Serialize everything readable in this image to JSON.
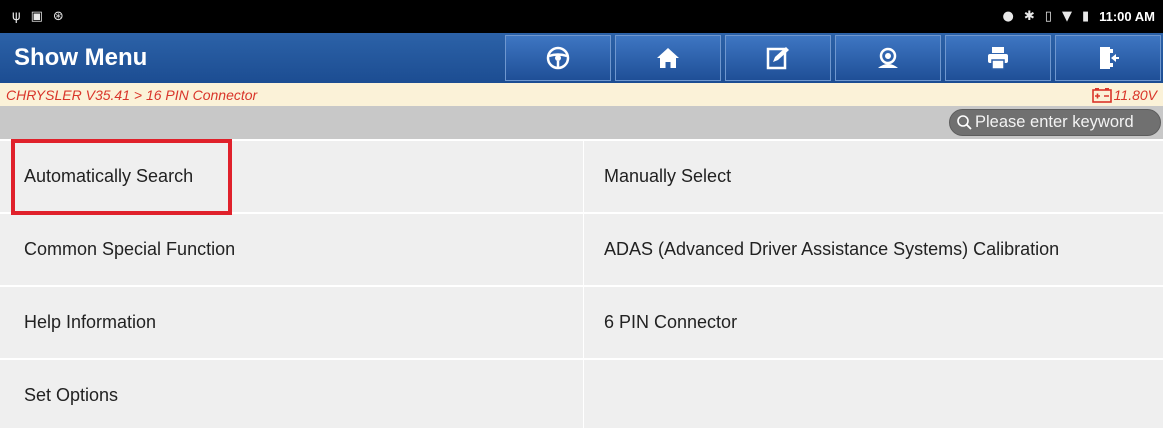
{
  "status_bar": {
    "left_icons": [
      "usb-icon",
      "image-icon",
      "bluetooth-badge-icon"
    ],
    "right_icons": [
      "location-icon",
      "bluetooth-icon",
      "vibrate-icon",
      "wifi-icon",
      "battery-icon"
    ],
    "time": "11:00 AM"
  },
  "header": {
    "title": "Show Menu",
    "toolbar": [
      "steering-wheel-icon",
      "home-icon",
      "edit-report-icon",
      "support-icon",
      "print-icon",
      "exit-icon"
    ]
  },
  "breadcrumb": {
    "path": "CHRYSLER V35.41 > 16 PIN Connector",
    "voltage": "11.80V"
  },
  "search": {
    "placeholder": "Please enter keyword"
  },
  "menu": {
    "items": [
      "Automatically Search",
      "Manually Select",
      "Common Special Function",
      "ADAS (Advanced Driver Assistance Systems) Calibration",
      "Help Information",
      "6 PIN Connector",
      "Set Options"
    ]
  },
  "colors": {
    "header_blue": "#1f5199",
    "breadcrumb_red": "#d9352a",
    "highlight_red": "#e0212b"
  }
}
